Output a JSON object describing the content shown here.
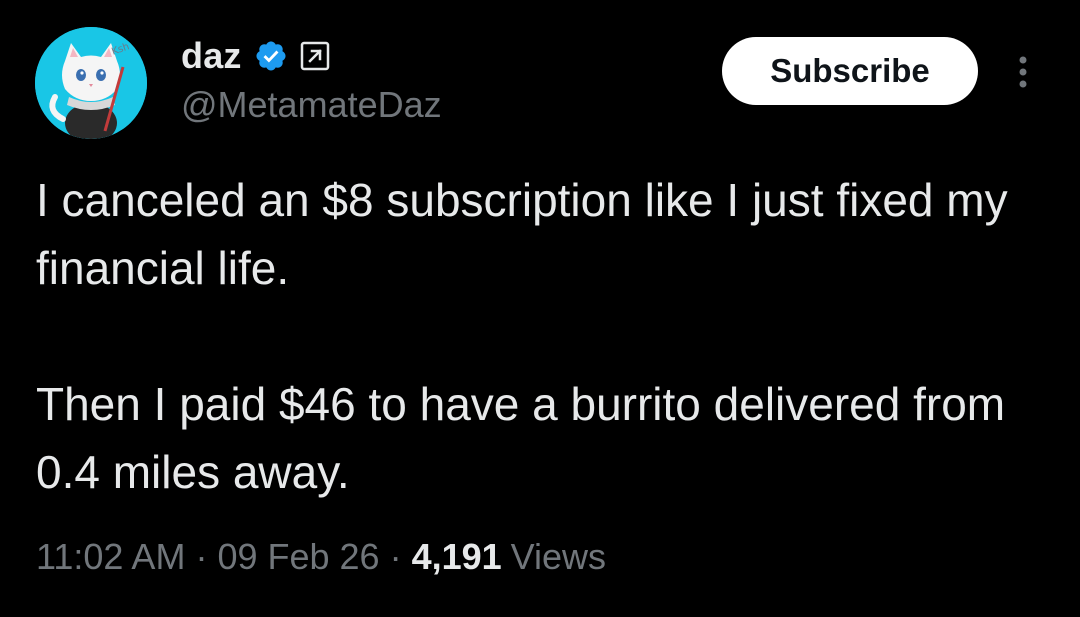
{
  "author": {
    "display_name": "daz",
    "handle": "@MetamateDaz",
    "avatar_icon": "cat-avatar-icon",
    "verified_icon": "verified-badge-icon",
    "affiliate_icon": "arrow-up-right-icon"
  },
  "actions": {
    "subscribe_label": "Subscribe",
    "more_icon": "more-vertical-icon"
  },
  "tweet": {
    "paragraph_1": "I canceled an $8 subscription like I just fixed my financial life.",
    "paragraph_2": "Then I paid $46 to have a burrito delivered from 0.4 miles away."
  },
  "meta": {
    "time": "11:02 AM",
    "separator": "·",
    "date": "09 Feb 26",
    "views_count": "4,191",
    "views_label": "Views"
  },
  "colors": {
    "background": "#000000",
    "primary_text": "#e7e9ea",
    "secondary_text": "#71767b",
    "verified_blue": "#1d9bf0",
    "avatar_bg": "#19c6e6"
  }
}
